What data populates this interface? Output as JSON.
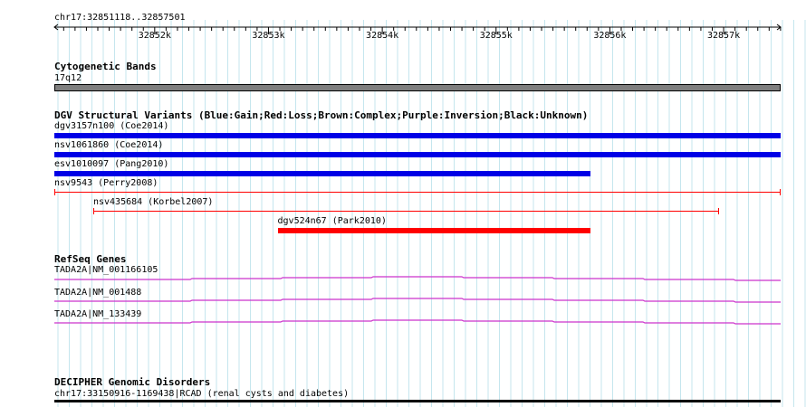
{
  "ruler": {
    "position_label": "chr17:32851118..32857501",
    "start": 32851118,
    "end": 32857501,
    "ticks": [
      {
        "pos": 32852000,
        "label": "32852k"
      },
      {
        "pos": 32853000,
        "label": "32853k"
      },
      {
        "pos": 32854000,
        "label": "32854k"
      },
      {
        "pos": 32855000,
        "label": "32855k"
      },
      {
        "pos": 32856000,
        "label": "32856k"
      },
      {
        "pos": 32857000,
        "label": "32857k"
      }
    ]
  },
  "tracks": {
    "cytoband": {
      "title": "Cytogenetic Bands",
      "band_label": "17q12",
      "color": "#7f7f7f"
    },
    "dgv": {
      "title": "DGV Structural Variants (Blue:Gain;Red:Loss;Brown:Complex;Purple:Inversion;Black:Unknown)",
      "gain_color": "#0000e6",
      "loss_color": "#ff0000",
      "features": [
        {
          "label": "dgv3157n100 (Coe2014)",
          "start": 32851118,
          "end": 32857501,
          "type": "gain",
          "style": "block"
        },
        {
          "label": "nsv1061860 (Coe2014)",
          "start": 32851118,
          "end": 32857501,
          "type": "gain",
          "style": "block"
        },
        {
          "label": "esv1010097 (Pang2010)",
          "start": 32851118,
          "end": 32855830,
          "type": "gain",
          "style": "block"
        },
        {
          "label": "nsv9543 (Perry2008)",
          "start": 32851118,
          "end": 32857501,
          "type": "loss",
          "style": "line"
        },
        {
          "label": "nsv435684 (Korbel2007)",
          "start": 32851460,
          "end": 32856960,
          "type": "loss",
          "style": "line"
        },
        {
          "label": "dgv524n67 (Park2010)",
          "start": 32853080,
          "end": 32855830,
          "type": "loss",
          "style": "block"
        }
      ]
    },
    "refseq": {
      "title": "RefSeq Genes",
      "color": "#cc33cc",
      "genes": [
        {
          "label": "TADA2A|NM_001166105"
        },
        {
          "label": "TADA2A|NM_001488"
        },
        {
          "label": "TADA2A|NM_133439"
        }
      ]
    },
    "decipher": {
      "title": "DECIPHER Genomic Disorders",
      "label": "chr17:33150916-1169438|RCAD (renal cysts and diabetes)",
      "color": "#000000"
    }
  }
}
